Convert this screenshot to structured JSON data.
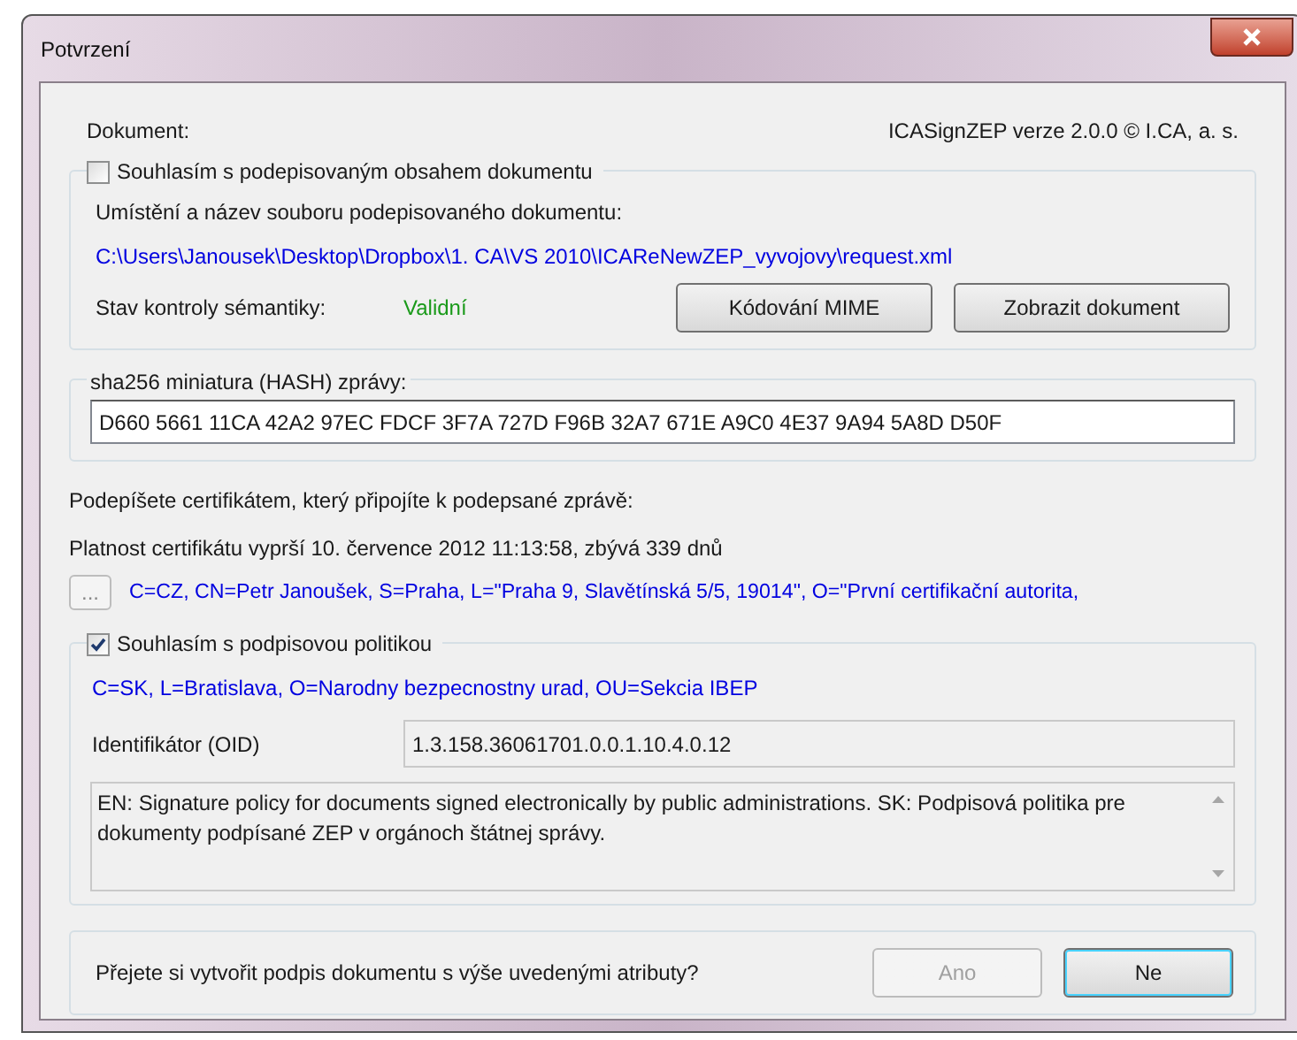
{
  "window": {
    "title": "Potvrzení"
  },
  "document": {
    "label": "Dokument:",
    "version": "ICASignZEP verze 2.0.0 © I.CA, a. s.",
    "consent": {
      "label": "Souhlasím s podepisovaným obsahem dokumentu",
      "checked": false
    },
    "location_label": "Umístění a název souboru podepisovaného dokumentu:",
    "path": "C:\\Users\\Janousek\\Desktop\\Dropbox\\1. CA\\VS 2010\\ICAReNewZEP_vyvojovy\\request.xml",
    "semantics_label": "Stav kontroly sémantiky:",
    "semantics_value": "Validní",
    "buttons": [
      "Kódování MIME",
      "Zobrazit dokument"
    ]
  },
  "hash": {
    "label": "sha256 miniatura (HASH) zprávy:",
    "value": "D660 5661 11CA 42A2 97EC FDCF 3F7A 727D F96B 32A7 671E A9C0 4E37 9A94 5A8D D50F"
  },
  "certificate": {
    "intro": "Podepíšete certifikátem, který připojíte k podepsané zprávě:",
    "validity": "Platnost certifikátu vyprší 10. července 2012 11:13:58, zbývá 339 dnů",
    "browse_button": "...",
    "subject": "C=CZ, CN=Petr Janoušek, S=Praha, L=\"Praha 9, Slavětínská 5/5, 19014\", O=\"První certifikační autorita,"
  },
  "policy": {
    "consent": {
      "label": "Souhlasím s podpisovou politikou",
      "checked": true
    },
    "issuer": "C=SK, L=Bratislava, O=Narodny bezpecnostny urad, OU=Sekcia IBEP",
    "oid_label": "Identifikátor (OID)",
    "oid_value": "1.3.158.36061701.0.0.1.10.4.0.12",
    "description": "EN: Signature policy for documents signed electronically by public administrations. SK: Podpisová politika pre dokumenty podpísané ZEP v orgánoch štátnej správy."
  },
  "footer": {
    "question": "Přejete si vytvořit podpis dokumentu s výše uvedenými atributy?",
    "buttons": [
      {
        "label": "Ano",
        "disabled": true,
        "default": false
      },
      {
        "label": "Ne",
        "disabled": false,
        "default": true
      }
    ]
  }
}
